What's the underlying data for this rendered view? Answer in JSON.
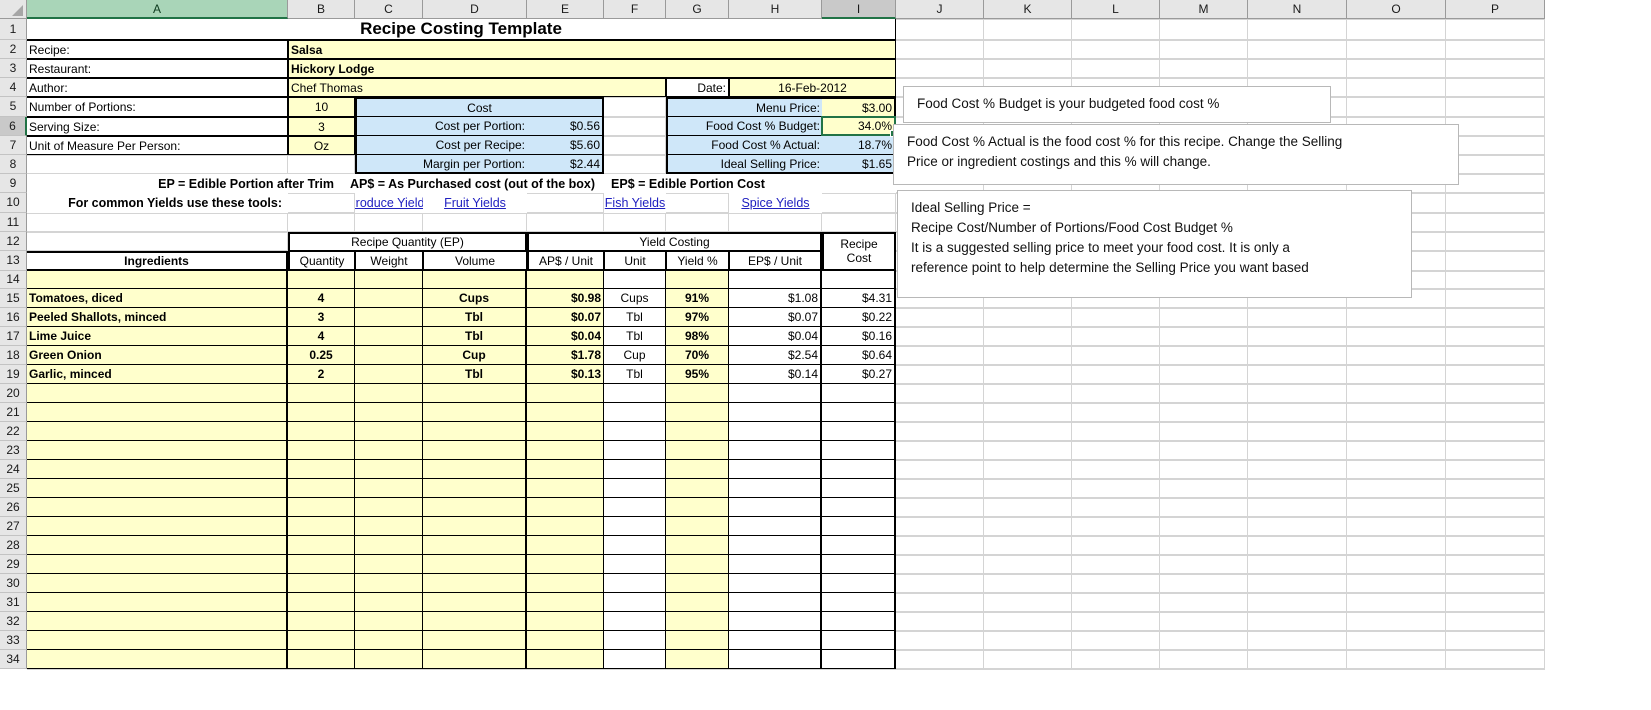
{
  "app": {
    "type": "spreadsheet",
    "column_headers": [
      "A",
      "B",
      "C",
      "D",
      "E",
      "F",
      "G",
      "H",
      "I",
      "J",
      "K",
      "L",
      "M",
      "N",
      "O",
      "P"
    ],
    "selected_column": "A",
    "active_column": "I",
    "active_row": 6,
    "active_cell": "I6",
    "row_numbers": [
      1,
      2,
      3,
      4,
      5,
      6,
      7,
      8,
      9,
      10,
      11,
      12,
      13,
      14,
      15,
      16,
      17,
      18,
      19,
      20,
      21,
      22,
      23,
      24,
      25,
      26,
      27,
      28,
      29,
      30,
      31,
      32,
      33,
      34
    ]
  },
  "colors": {
    "input_yellow": "#ffffcc",
    "calc_blue": "#cfe7f9",
    "header_gray": "#e6e6e6",
    "selected_green": "#a9d5b8",
    "active_outline": "#217346",
    "link_blue": "#2020c0"
  },
  "sheet": {
    "title": "Recipe Costing Template",
    "info": {
      "recipe_label": "Recipe:",
      "recipe_value": "Salsa",
      "restaurant_label": "Restaurant:",
      "restaurant_value": "Hickory Lodge",
      "author_label": "Author:",
      "author_value": "Chef Thomas",
      "date_label": "Date:",
      "date_value": "16-Feb-2012",
      "portions_label": "Number of Portions:",
      "portions_value": "10",
      "serving_size_label": "Serving Size:",
      "serving_size_value": "3",
      "uom_label": "Unit of Measure Per Person:",
      "uom_value": "Oz"
    },
    "cost_panel": {
      "heading": "Cost",
      "rows": [
        {
          "label": "Cost per Portion:",
          "value": "$0.56"
        },
        {
          "label": "Cost per Recipe:",
          "value": "$5.60"
        },
        {
          "label": "Margin per Portion:",
          "value": "$2.44"
        }
      ]
    },
    "price_panel": {
      "rows": [
        {
          "label": "Menu Price:",
          "value": "$3.00",
          "fill": "yellow"
        },
        {
          "label": "Food Cost % Budget:",
          "value": "34.0%",
          "fill": "yellow"
        },
        {
          "label": "Food Cost % Actual:",
          "value": "18.7%",
          "fill": "blue"
        },
        {
          "label": "Ideal Selling Price:",
          "value": "$1.65",
          "fill": "blue"
        }
      ]
    },
    "legend": {
      "ep": "EP = Edible Portion after Trim",
      "ap_dollar": "AP$ = As Purchased cost (out of the box)",
      "ep_dollar": "EP$ = Edible Portion Cost"
    },
    "tools": {
      "label": "For common Yields use these tools:",
      "links": [
        "Produce Yields",
        "Fruit Yields",
        "Fish Yields",
        "Spice Yields"
      ]
    },
    "table": {
      "group_headers": [
        {
          "label": "Recipe Quantity (EP)"
        },
        {
          "label": "Yield Costing"
        },
        {
          "label": "Recipe Cost"
        }
      ],
      "columns": [
        "Ingredients",
        "Quantity",
        "Weight",
        "Volume",
        "AP$ / Unit",
        "Unit",
        "Yield %",
        "EP$ / Unit",
        "Recipe Cost"
      ],
      "rows": [
        {
          "ingredient": "",
          "quantity": "",
          "weight": "",
          "volume": "",
          "ap_unit": "",
          "unit": "",
          "yield": "",
          "ep_unit": "",
          "recipe_cost": ""
        },
        {
          "ingredient": "Tomatoes, diced",
          "quantity": "4",
          "weight": "",
          "volume": "Cups",
          "ap_unit": "$0.98",
          "unit": "Cups",
          "yield": "91%",
          "ep_unit": "$1.08",
          "recipe_cost": "$4.31"
        },
        {
          "ingredient": "Peeled Shallots, minced",
          "quantity": "3",
          "weight": "",
          "volume": "Tbl",
          "ap_unit": "$0.07",
          "unit": "Tbl",
          "yield": "97%",
          "ep_unit": "$0.07",
          "recipe_cost": "$0.22"
        },
        {
          "ingredient": "Lime Juice",
          "quantity": "4",
          "weight": "",
          "volume": "Tbl",
          "ap_unit": "$0.04",
          "unit": "Tbl",
          "yield": "98%",
          "ep_unit": "$0.04",
          "recipe_cost": "$0.16"
        },
        {
          "ingredient": "Green Onion",
          "quantity": "0.25",
          "weight": "",
          "volume": "Cup",
          "ap_unit": "$1.78",
          "unit": "Cup",
          "yield": "70%",
          "ep_unit": "$2.54",
          "recipe_cost": "$0.64"
        },
        {
          "ingredient": "Garlic, minced",
          "quantity": "2",
          "weight": "",
          "volume": "Tbl",
          "ap_unit": "$0.13",
          "unit": "Tbl",
          "yield": "95%",
          "ep_unit": "$0.14",
          "recipe_cost": "$0.27"
        }
      ]
    },
    "comments": [
      {
        "id": "food-cost-budget-comment",
        "lines": [
          "Food Cost % Budget is your budgeted food cost %"
        ]
      },
      {
        "id": "food-cost-actual-comment",
        "lines": [
          "Food Cost % Actual is the food cost % for this recipe.  Change the Selling",
          "Price or ingredient costings and this % will change."
        ]
      },
      {
        "id": "ideal-selling-price-comment",
        "lines": [
          "Ideal Selling Price =",
          "Recipe Cost/Number of Portions/Food Cost Budget %",
          "It is a suggested selling price to meet your food cost.  It is only a",
          "reference point to help determine the Selling Price you want based"
        ]
      }
    ]
  }
}
